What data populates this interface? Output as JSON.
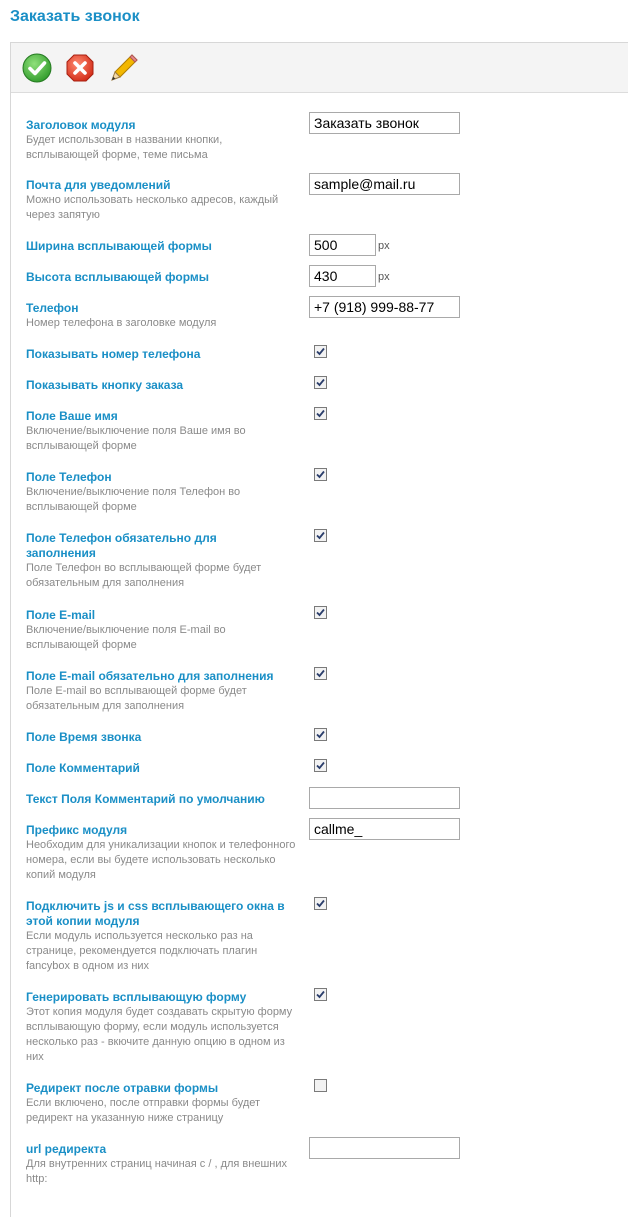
{
  "page": {
    "title": "Заказать звонок"
  },
  "toolbar": {
    "save": {
      "icon": "checkmark-icon",
      "color": "#3ba936"
    },
    "cancel": {
      "icon": "close-icon",
      "color": "#e1412b"
    },
    "edit": {
      "icon": "pencil-icon",
      "color": "#f0b400"
    }
  },
  "fields": {
    "module_title": {
      "label": "Заголовок модуля",
      "desc": "Будет использован в названии кнопки, всплывающей форме, теме письма",
      "value": "Заказать звонок"
    },
    "notify_email": {
      "label": "Почта для уведомлений",
      "desc": "Можно использовать несколько адресов, каждый через запятую",
      "value": "sample@mail.ru"
    },
    "popup_width": {
      "label": "Ширина всплывающей формы",
      "value": "500",
      "unit": "px"
    },
    "popup_height": {
      "label": "Высота всплывающей формы",
      "value": "430",
      "unit": "px"
    },
    "phone": {
      "label": "Телефон",
      "desc": "Номер телефона в заголовке модуля",
      "value": "+7 (918) 999-88-77"
    },
    "show_phone": {
      "label": "Показывать номер телефона",
      "checked": true
    },
    "show_order_button": {
      "label": "Показывать кнопку заказа",
      "checked": true
    },
    "field_name": {
      "label": "Поле Ваше имя",
      "desc": "Включение/выключение поля Ваше имя во всплывающей форме",
      "checked": true
    },
    "field_phone": {
      "label": "Поле Телефон",
      "desc": "Включение/выключение поля Телефон во всплывающей форме",
      "checked": true
    },
    "field_phone_required": {
      "label": "Поле Телефон обязательно для заполнения",
      "desc": "Поле Телефон во всплывающей форме будет обязательным для заполнения",
      "checked": true
    },
    "field_email": {
      "label": "Поле E-mail",
      "desc": "Включение/выключение поля E-mail во всплывающей форме",
      "checked": true
    },
    "field_email_required": {
      "label": "Поле E-mail обязательно для заполнения",
      "desc": "Поле E-mail во всплывающей форме будет обязательным для заполнения",
      "checked": true
    },
    "field_call_time": {
      "label": "Поле Время звонка",
      "checked": true
    },
    "field_comment": {
      "label": "Поле Комментарий",
      "checked": true
    },
    "comment_default": {
      "label": "Текст Поля Комментарий по умолчанию",
      "value": ""
    },
    "module_prefix": {
      "label": "Префикс модуля",
      "desc": "Необходим для уникализации кнопок и телефонного номера, если вы будете использовать несколько копий модуля",
      "value": "callme_"
    },
    "include_js_css": {
      "label": "Подключить js и css всплывающего окна в этой копии модуля",
      "desc": "Если модуль используется несколько раз на странице, рекомендуется подключать плагин fancybox в одном из них",
      "checked": true
    },
    "generate_popup": {
      "label": "Генерировать всплывающую форму",
      "desc": "Этот копия модуля будет создавать скрытую форму всплывающую форму, если модуль используется несколько раз - вкючите данную опцию в одном из них",
      "checked": true
    },
    "redirect_after_submit": {
      "label": "Редирект после отравки формы",
      "desc": "Если включено, после отправки формы будет редирект на указанную ниже страницу",
      "checked": false
    },
    "redirect_url": {
      "label": "url редиректа",
      "desc": "Для внутренних страниц начиная с / , для внешних http:",
      "value": ""
    }
  }
}
